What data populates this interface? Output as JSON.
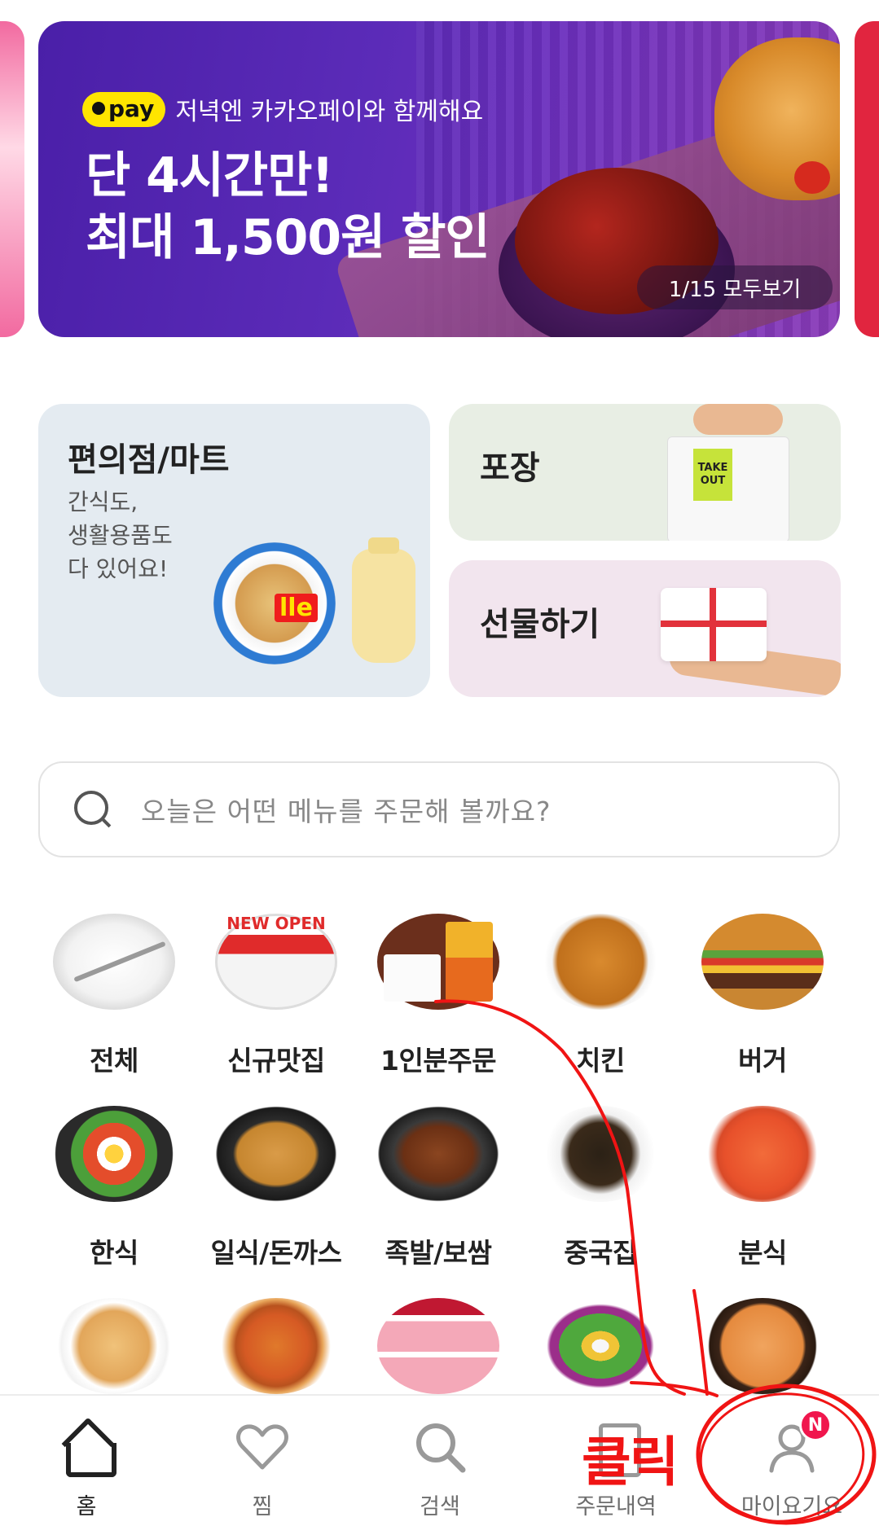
{
  "banner": {
    "pay_badge": "pay",
    "pay_text": "저녁엔 카카오페이와 함께해요",
    "headline_line1": "단 4시간만!",
    "headline_line2": "최대 1,500원 할인",
    "pager": "1/15 모두보기"
  },
  "cards": {
    "convenience": {
      "title": "편의점/마트",
      "desc_line1": "간식도,",
      "desc_line2": "생활용품도",
      "desc_line3": "다 있어요!",
      "product_label": "lle"
    },
    "pickup": {
      "title": "포장",
      "bag_tag": "TAKE OUT"
    },
    "gift": {
      "title": "선물하기"
    }
  },
  "search": {
    "placeholder": "오늘은 어떤 메뉴를 주문해 볼까요?",
    "icon": "search-icon"
  },
  "categories": [
    {
      "label": "전체",
      "icon": "plate-icon"
    },
    {
      "label": "신규맛집",
      "icon": "new-shop-icon",
      "sign": "NEW OPEN"
    },
    {
      "label": "1인분주문",
      "icon": "bento-icon"
    },
    {
      "label": "치킨",
      "icon": "chicken-icon"
    },
    {
      "label": "버거",
      "icon": "burger-icon"
    },
    {
      "label": "한식",
      "icon": "bibimbap-icon"
    },
    {
      "label": "일식/돈까스",
      "icon": "katsu-icon"
    },
    {
      "label": "족발/보쌈",
      "icon": "jokbal-icon"
    },
    {
      "label": "중국집",
      "icon": "jjajang-icon"
    },
    {
      "label": "분식",
      "icon": "tteokbokki-icon"
    },
    {
      "label": "",
      "icon": "pho-icon"
    },
    {
      "label": "",
      "icon": "pizza-icon"
    },
    {
      "label": "",
      "icon": "cake-icon"
    },
    {
      "label": "",
      "icon": "salad-icon"
    },
    {
      "label": "",
      "icon": "soup-icon"
    }
  ],
  "bottom_nav": {
    "home": "홈",
    "wishlist": "찜",
    "search": "검색",
    "orders": "주문내역",
    "my": "마이요기요",
    "my_badge": "N"
  },
  "annotation": {
    "text": "클릭",
    "color": "#f01414"
  },
  "colors": {
    "banner_purple": "#4a1fa8",
    "pay_yellow": "#ffe500",
    "convenience_bg": "#e4ebf1",
    "pickup_bg": "#e8eee4",
    "gift_bg": "#f2e5ee",
    "badge_pink": "#f0164d"
  }
}
